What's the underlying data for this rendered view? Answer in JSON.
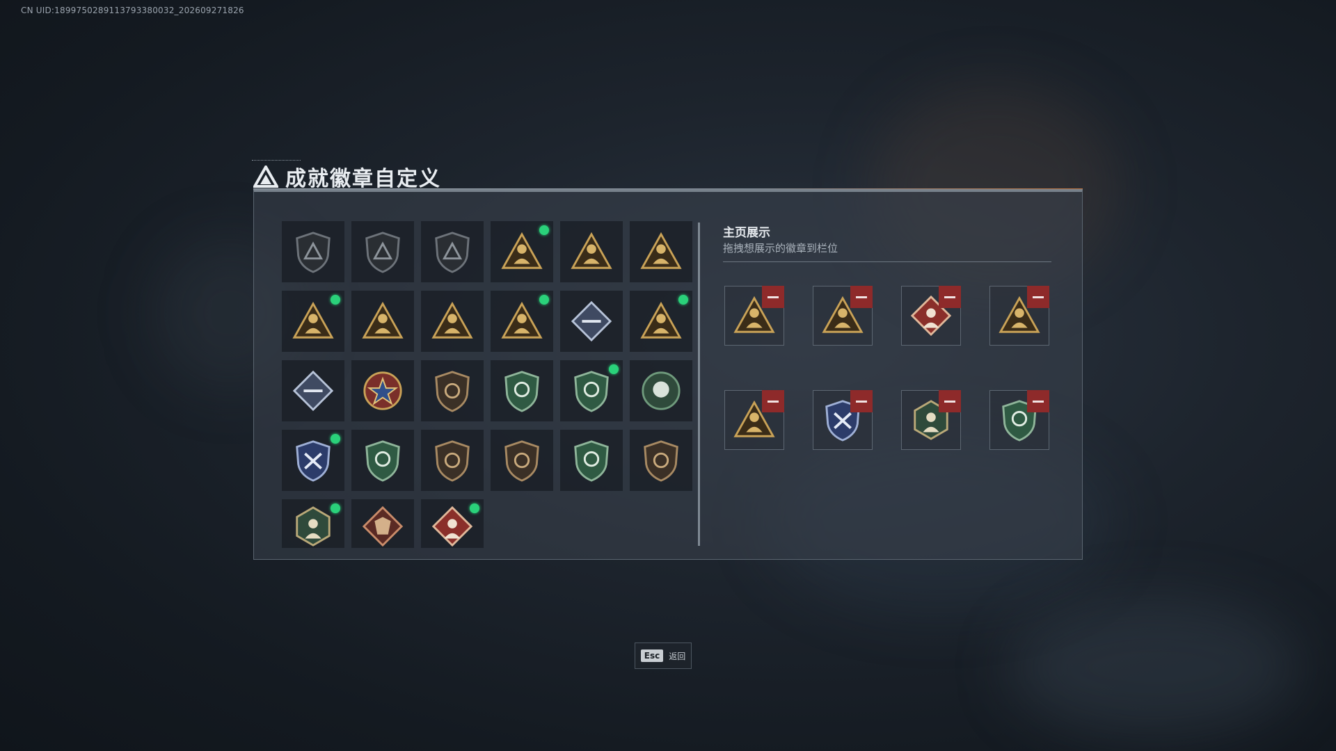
{
  "uid_text": "CN UID:1899750289113793380032_202609271826",
  "page_title": "成就徽章自定义",
  "showcase": {
    "title": "主页展示",
    "subtitle": "拖拽想展示的徽章到栏位"
  },
  "footer": {
    "esc_key": "Esc",
    "esc_label": "返回"
  },
  "colors": {
    "accent_new": "#2ad17a",
    "remove": "#8e2a2a"
  },
  "badges": [
    {
      "icon": "delta-shield-badge-icon",
      "new": false
    },
    {
      "icon": "helicopter-shield-badge-icon",
      "new": false
    },
    {
      "icon": "arrow-shield-badge-icon",
      "new": false
    },
    {
      "icon": "gold-turret-triangle-badge-icon",
      "new": true
    },
    {
      "icon": "gold-hand-triangle-badge-icon",
      "new": false
    },
    {
      "icon": "gold-gold-bars-triangle-badge-icon",
      "new": false
    },
    {
      "icon": "gold-helmet-triangle-badge-icon",
      "new": true
    },
    {
      "icon": "gold-creature-triangle-badge-icon",
      "new": false
    },
    {
      "icon": "gold-number-two-triangle-badge-icon",
      "new": false
    },
    {
      "icon": "gold-soldier-triangle-badge-icon",
      "new": true
    },
    {
      "icon": "silver-rose-diamond-badge-icon",
      "new": false
    },
    {
      "icon": "gold-firefighter-triangle-badge-icon",
      "new": true
    },
    {
      "icon": "silver-rifle-diamond-badge-icon",
      "new": false
    },
    {
      "icon": "star-medal-badge-icon",
      "new": false
    },
    {
      "icon": "bronze-shield-badge-icon",
      "new": false
    },
    {
      "icon": "green-shield-emblem-badge-icon",
      "new": false
    },
    {
      "icon": "green-shield-gem-badge-icon",
      "new": true
    },
    {
      "icon": "green-flower-badge-icon",
      "new": false
    },
    {
      "icon": "blue-crossed-rifles-shield-badge-icon",
      "new": true
    },
    {
      "icon": "green-crossed-rifles-shield-badge-icon",
      "new": false
    },
    {
      "icon": "bronze-rifle-shield-badge-icon",
      "new": false
    },
    {
      "icon": "bronze-rifle-shield-2-badge-icon",
      "new": false
    },
    {
      "icon": "green-rifles-shield-badge-icon",
      "new": false
    },
    {
      "icon": "bronze-spear-badge-icon",
      "new": false
    },
    {
      "icon": "green-hex-operator-badge-icon",
      "new": true
    },
    {
      "icon": "red-dragon-badge-icon",
      "new": false
    },
    {
      "icon": "red-operator-diamond-badge-icon",
      "new": true
    }
  ],
  "showcase_slots": [
    {
      "icon": "gold-firefighter-triangle-badge-icon"
    },
    {
      "icon": "gold-soldier-triangle-badge-icon"
    },
    {
      "icon": "red-operator-diamond-badge-icon"
    },
    {
      "icon": "gold-turret-triangle-badge-icon"
    },
    {
      "icon": "gold-helmet-triangle-badge-icon"
    },
    {
      "icon": "blue-crossed-rifles-shield-badge-icon"
    },
    {
      "icon": "green-hex-operator-badge-icon"
    },
    {
      "icon": "green-shield-gem-badge-icon"
    }
  ]
}
